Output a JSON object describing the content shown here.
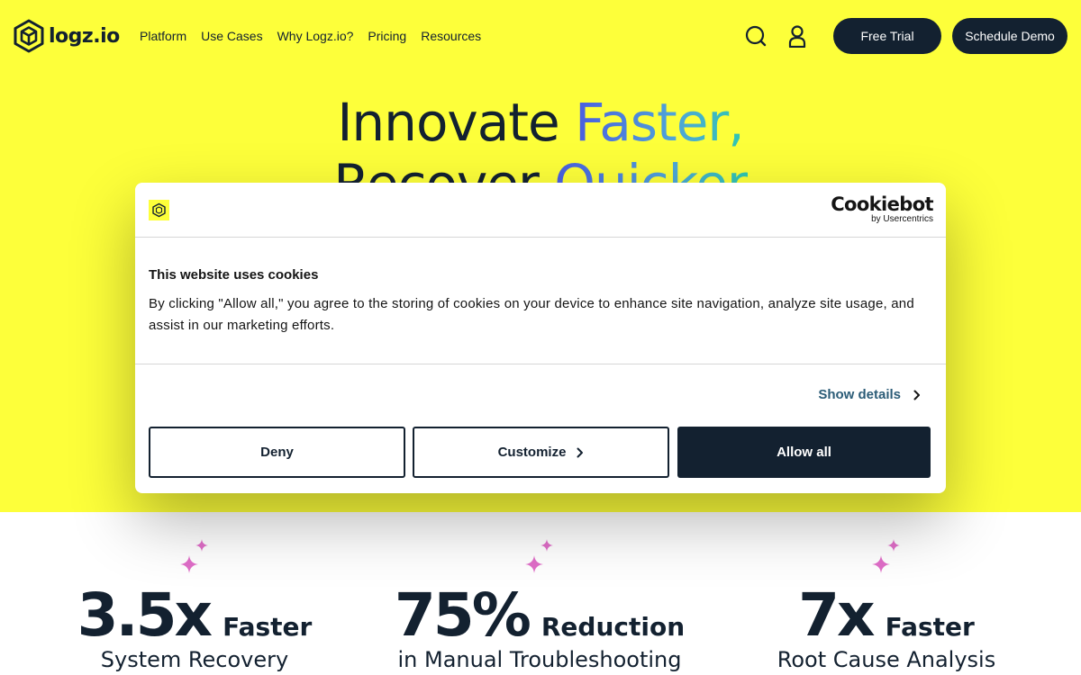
{
  "header": {
    "logo_text": "logz.io",
    "nav": [
      "Platform",
      "Use Cases",
      "Why Logz.io?",
      "Pricing",
      "Resources"
    ],
    "search_icon": "search-icon",
    "user_icon": "user-icon",
    "free_trial": "Free Trial",
    "schedule_demo": "Schedule Demo"
  },
  "hero": {
    "line1_plain": "Innovate ",
    "line1_accent": "Faster,",
    "line2_plain": "Recover ",
    "line2_accent": "Quicker"
  },
  "stats": [
    {
      "number": "3.5x",
      "word": "Faster",
      "sub": "System Recovery"
    },
    {
      "number": "75%",
      "word": "Reduction",
      "sub": "in Manual Troubleshooting"
    },
    {
      "number": "7x",
      "word": "Faster",
      "sub": "Root Cause Analysis"
    }
  ],
  "cookie": {
    "mini_logo_text": "logz.io",
    "brand": "Cookiebot",
    "brand_sub": "by Usercentrics",
    "title": "This website uses cookies",
    "body": "By clicking \"Allow all,\" you agree to the storing of cookies on your device to enhance site navigation, analyze site usage, and assist in our marketing efforts.",
    "show_details": "Show details",
    "deny": "Deny",
    "customize": "Customize",
    "allow_all": "Allow all"
  },
  "colors": {
    "brand_yellow": "#fdff3a",
    "navy": "#132130",
    "sparkle_pink": "#e06ec8",
    "link_blue": "#2b5c77"
  }
}
